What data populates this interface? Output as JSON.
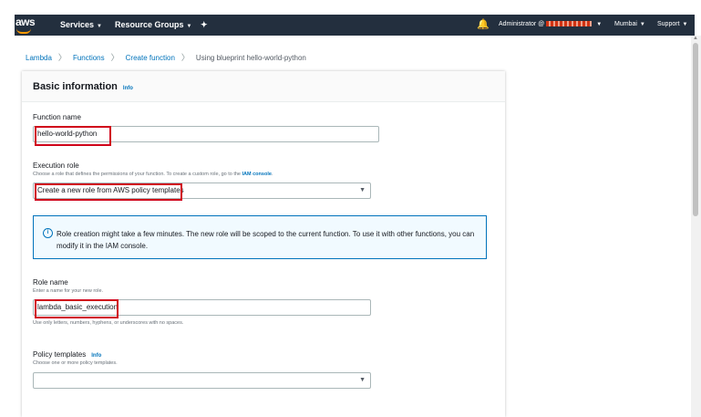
{
  "topnav": {
    "logo": "aws",
    "services": "Services",
    "resource_groups": "Resource Groups",
    "account": "Administrator @",
    "region": "Mumbai",
    "support": "Support"
  },
  "breadcrumb": [
    "Lambda",
    "Functions",
    "Create function",
    "Using blueprint hello-world-python"
  ],
  "panel": {
    "title": "Basic information",
    "info": "Info"
  },
  "function_name": {
    "label": "Function name",
    "value": "hello-world-python"
  },
  "execution_role": {
    "label": "Execution role",
    "description": "Choose a role that defines the permissions of your function. To create a custom role, go to the",
    "description_link": "IAM console",
    "value": "Create a new role from AWS policy templates"
  },
  "alert": {
    "text": "Role creation might take a few minutes. The new role will be scoped to the current function. To use it with other functions, you can modify it in the IAM console."
  },
  "role_name": {
    "label": "Role name",
    "description": "Enter a name for your new role.",
    "value": "lambda_basic_execution",
    "hint": "Use only letters, numbers, hyphens, or underscores with no spaces."
  },
  "policy_templates": {
    "label": "Policy templates",
    "info": "Info",
    "description": "Choose one or more policy templates.",
    "value": ""
  },
  "colors": {
    "nav_bg": "#232f3e",
    "accent": "#ff9900",
    "link": "#0073bb",
    "highlight": "#d0021b"
  }
}
